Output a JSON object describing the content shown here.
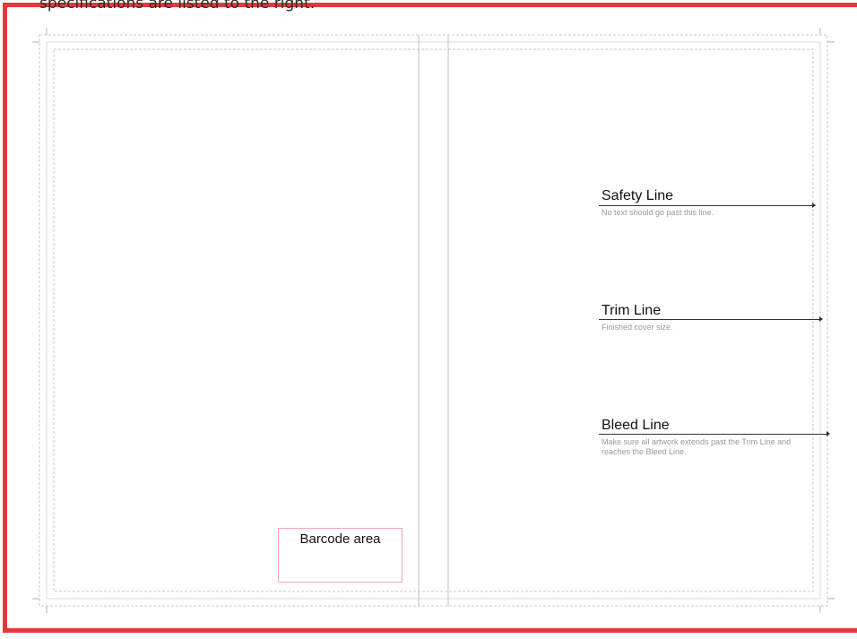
{
  "intro": {
    "text": "specifications are listed to the right."
  },
  "template": {
    "barcode_label": "Barcode area",
    "callouts": [
      {
        "title": "Safety Line",
        "description": "No text should go past this line."
      },
      {
        "title": "Trim Line",
        "description": "Finished cover size."
      },
      {
        "title": "Bleed Line",
        "description": "Make sure all artwork extends past the Trim Line and reaches the Bleed Line."
      }
    ]
  },
  "colors": {
    "frame": "#e03a3a",
    "barcode_border": "#efa7b3",
    "guide_lines": "#c8c8c8",
    "callout_text": "#9a9a9a"
  }
}
